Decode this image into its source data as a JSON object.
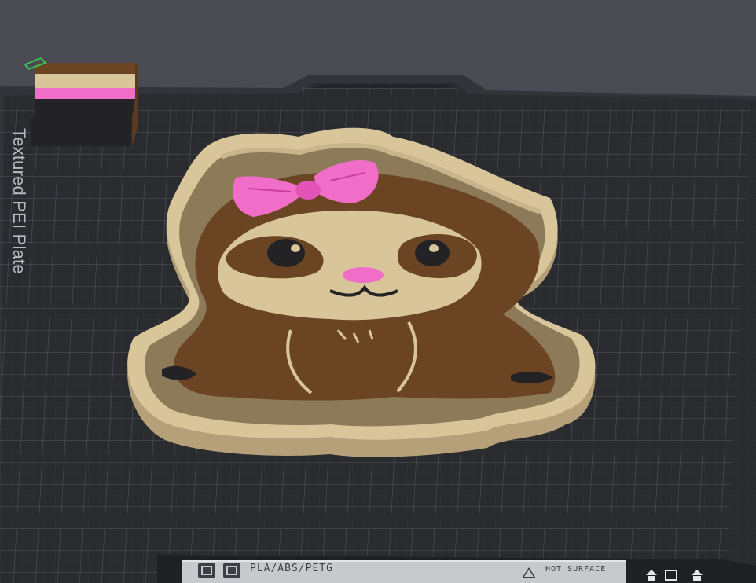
{
  "bed": {
    "label": "Textured PEI Plate",
    "material": "PLA/ABS/PETG",
    "hot_surface": "HOT SURFACE"
  },
  "icons": [
    "pause-icon",
    "window-icon",
    "warning-icon",
    "eject-icon",
    "square-icon"
  ],
  "colors": {
    "background": "#4a4b52",
    "bed_surface": "#2a2b2f",
    "bed_grid": "#585960",
    "bed_edge": "#3a3b40",
    "filament_tan": "#d8c59a",
    "filament_tan_side": "#c2ae85",
    "filament_brown": "#6b4423",
    "filament_brown_dark": "#4e2f17",
    "filament_pink": "#f06ec8",
    "filament_black": "#232325",
    "selection_green": "#3bbf59"
  },
  "objects": [
    {
      "name": "sloth-with-bow"
    },
    {
      "name": "prime-tower"
    }
  ]
}
